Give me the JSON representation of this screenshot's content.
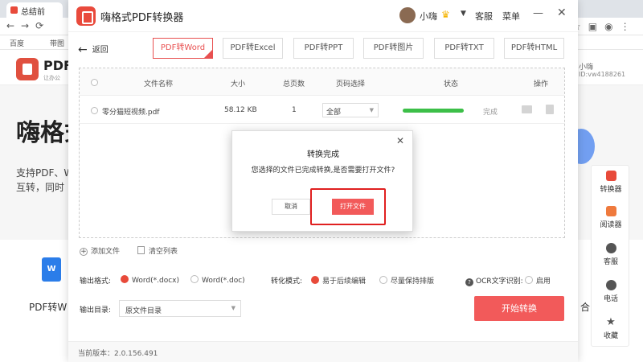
{
  "browser": {
    "tab_title": "总结前",
    "bookmarks": [
      "百度",
      "带图"
    ]
  },
  "website": {
    "logo_text": "PDF",
    "logo_sub": "让办公",
    "hero": "嗨格式",
    "desc_line1": "支持PDF、W",
    "desc_line2": "互转，同时",
    "card_label": "PDF转W",
    "card_right": "合",
    "user_name": "小嗨",
    "user_id": "ID:vw4188261",
    "side_items": [
      {
        "label": "转换器"
      },
      {
        "label": "阅读器"
      },
      {
        "label": "客服"
      },
      {
        "label": "电话"
      },
      {
        "label": "收藏"
      }
    ]
  },
  "app": {
    "title": "嗨格式PDF转换器",
    "username": "小嗨",
    "kefu": "客服",
    "menu": "菜单",
    "back": "返回",
    "tabs": [
      "PDF转Word",
      "PDF转Excel",
      "PDF转PPT",
      "PDF转图片",
      "PDF转TXT",
      "PDF转HTML"
    ],
    "table": {
      "headers": [
        "文件名称",
        "大小",
        "总页数",
        "页码选择",
        "状态",
        "操作"
      ],
      "rows": [
        {
          "name": "零分猫短视频.pdf",
          "size": "58.12 KB",
          "pages": "1",
          "page_select": "全部",
          "progress": 1.0,
          "status": "完成"
        }
      ]
    },
    "add_file": "添加文件",
    "clear_list": "清空列表",
    "output_format_label": "输出格式:",
    "format_docx": "Word(*.docx)",
    "format_doc": "Word(*.doc)",
    "mode_label": "转化模式:",
    "mode_edit": "易于后续编辑",
    "mode_layout": "尽量保持排版",
    "ocr_label": "OCR文字识别:",
    "ocr_enable": "启用",
    "output_dir_label": "输出目录:",
    "output_dir_value": "原文件目录",
    "start_button": "开始转换",
    "version": "当前版本：2.0.156.491"
  },
  "modal": {
    "title": "转换完成",
    "message": "您选择的文件已完成转换,是否需要打开文件?",
    "cancel": "取消",
    "open": "打开文件"
  },
  "colors": {
    "accent": "#f25a5a",
    "progress": "#3cbf48",
    "highlight": "#e02020"
  }
}
